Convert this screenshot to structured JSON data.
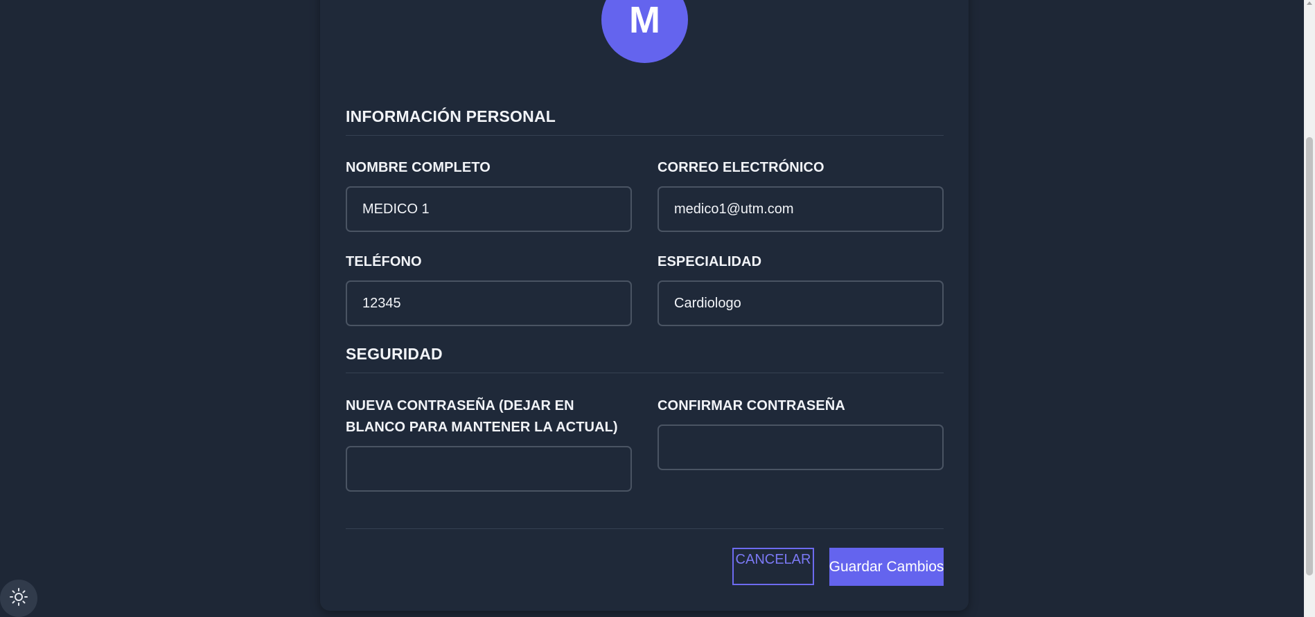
{
  "avatar": {
    "initial": "M"
  },
  "personal": {
    "title": "INFORMACIÓN PERSONAL",
    "fields": {
      "name": {
        "label": "NOMBRE COMPLETO",
        "value": "MEDICO 1"
      },
      "email": {
        "label": "CORREO ELECTRÓNICO",
        "value": "medico1@utm.com"
      },
      "phone": {
        "label": "TELÉFONO",
        "value": "12345"
      },
      "specialty": {
        "label": "ESPECIALIDAD",
        "value": "Cardiologo"
      }
    }
  },
  "security": {
    "title": "SEGURIDAD",
    "fields": {
      "new_password": {
        "label": "NUEVA CONTRASEÑA (DEJAR EN BLANCO PARA MANTENER LA ACTUAL)",
        "value": ""
      },
      "confirm_password": {
        "label": "CONFIRMAR CONTRASEÑA",
        "value": ""
      }
    }
  },
  "actions": {
    "cancel_label": "CANCELAR",
    "save_label": "Guardar Cambios"
  },
  "theme_toggle": {
    "icon": "sun-icon"
  },
  "colors": {
    "background": "#1e2736",
    "card": "#1f2939",
    "accent": "#6464ee",
    "input_border": "#4a5463"
  }
}
